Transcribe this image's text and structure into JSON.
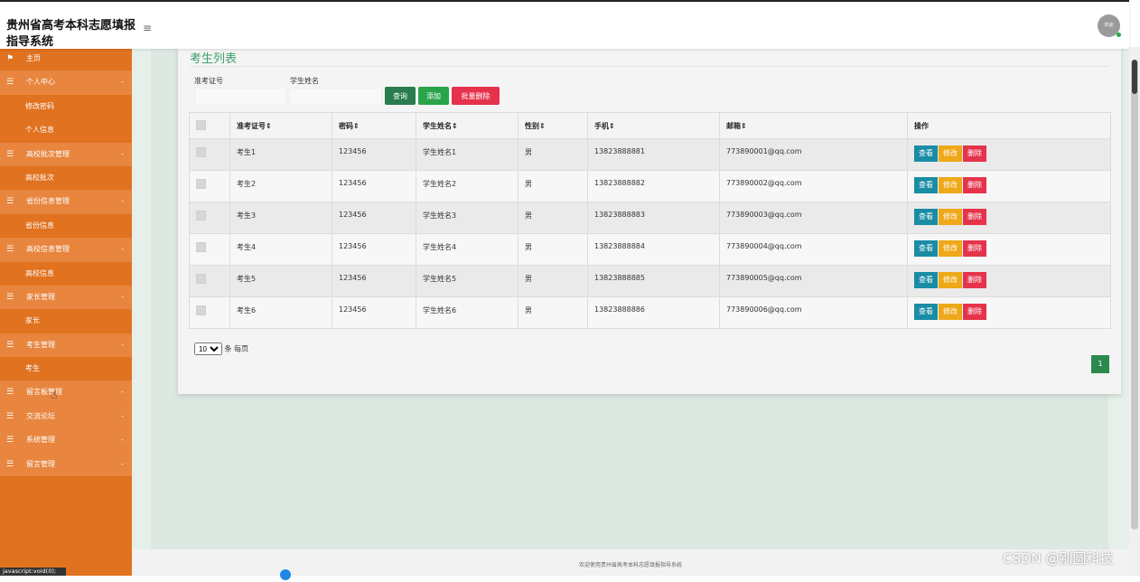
{
  "header": {
    "title": "贵州省高考本科志愿填报指导系统",
    "menu_toggle_glyph": "≡",
    "avatar_text": "欢迎"
  },
  "sidebar": {
    "items": [
      {
        "label": "主页",
        "icon": "flag-icon",
        "type": "top"
      },
      {
        "label": "个人中心",
        "icon": "menu-icon",
        "type": "group"
      },
      {
        "label": "修改密码",
        "type": "sub"
      },
      {
        "label": "个人信息",
        "type": "sub"
      },
      {
        "label": "高校批次管理",
        "icon": "menu-icon",
        "type": "group"
      },
      {
        "label": "高校批次",
        "type": "sub"
      },
      {
        "label": "省份信息管理",
        "icon": "menu-icon",
        "type": "group"
      },
      {
        "label": "省份信息",
        "type": "sub"
      },
      {
        "label": "高校信息管理",
        "icon": "menu-icon",
        "type": "group"
      },
      {
        "label": "高校信息",
        "type": "sub"
      },
      {
        "label": "家长管理",
        "icon": "menu-icon",
        "type": "group"
      },
      {
        "label": "家长",
        "type": "sub"
      },
      {
        "label": "考生管理",
        "icon": "menu-icon",
        "type": "group"
      },
      {
        "label": "考生",
        "type": "sub"
      },
      {
        "label": "留言板管理",
        "icon": "menu-icon",
        "type": "group"
      },
      {
        "label": "交流论坛",
        "icon": "menu-icon",
        "type": "group"
      },
      {
        "label": "系统管理",
        "icon": "menu-icon",
        "type": "group"
      },
      {
        "label": "留言管理",
        "icon": "menu-icon",
        "type": "group"
      }
    ],
    "caret_glyph": "-"
  },
  "main": {
    "card_title": "考生列表",
    "filters": {
      "ticket_label": "准考证号",
      "ticket_value": "",
      "name_label": "学生姓名",
      "name_value": ""
    },
    "buttons": {
      "search": "查询",
      "add": "添加",
      "batch_delete": "批量删除"
    },
    "table": {
      "columns": [
        "准考证号",
        "密码",
        "学生姓名",
        "性别",
        "手机",
        "邮箱",
        "操作"
      ],
      "sort_glyph": "⇕",
      "rows": [
        {
          "ticket": "考生1",
          "password": "123456",
          "name": "学生姓名1",
          "gender": "男",
          "phone": "13823888881",
          "email": "773890001@qq.com"
        },
        {
          "ticket": "考生2",
          "password": "123456",
          "name": "学生姓名2",
          "gender": "男",
          "phone": "13823888882",
          "email": "773890002@qq.com"
        },
        {
          "ticket": "考生3",
          "password": "123456",
          "name": "学生姓名3",
          "gender": "男",
          "phone": "13823888883",
          "email": "773890003@qq.com"
        },
        {
          "ticket": "考生4",
          "password": "123456",
          "name": "学生姓名4",
          "gender": "男",
          "phone": "13823888884",
          "email": "773890004@qq.com"
        },
        {
          "ticket": "考生5",
          "password": "123456",
          "name": "学生姓名5",
          "gender": "男",
          "phone": "13823888885",
          "email": "773890005@qq.com"
        },
        {
          "ticket": "考生6",
          "password": "123456",
          "name": "学生姓名6",
          "gender": "男",
          "phone": "13823888886",
          "email": "773890006@qq.com"
        }
      ],
      "actions": {
        "view": "查看",
        "edit": "修改",
        "delete": "删除"
      }
    },
    "pagination": {
      "page_size": "10",
      "page_size_suffix": "条 每页",
      "current_page": "1"
    }
  },
  "footer": {
    "text": "欢迎使用贵州省高考本科志愿填报指导系统"
  },
  "statusbar": {
    "text": "javascript:void(0);"
  },
  "watermark": "CSDN @别圆科技",
  "colors": {
    "sidebar_bg": "#e07220",
    "sidebar_group_bg": "#e8853e",
    "accent_green": "#3ca06b",
    "view_btn": "#1a8ca4",
    "edit_btn": "#eea81a",
    "delete_btn": "#e5334b"
  }
}
